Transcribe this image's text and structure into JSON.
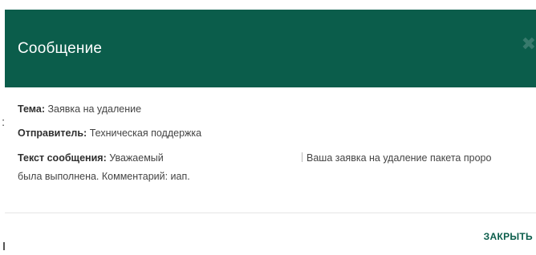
{
  "dialog": {
    "title": "Сообщение",
    "close_icon": "close-icon",
    "close_button_label": "ЗАКРЫТЬ"
  },
  "message": {
    "subject_label": "Тема:",
    "subject_value": "Заявка на удаление",
    "sender_label": "Отправитель:",
    "sender_value": "Техническая поддержка",
    "text_label": "Текст сообщения:",
    "text_value_start": "Уважаемый",
    "text_value_right": "Ваша заявка на удаление пакета проро",
    "text_value_line2": "была выполнена. Комментарий: иап."
  },
  "background": {
    "colon": ":"
  },
  "colors": {
    "header": "#0b5d4b",
    "accent": "#0b5d4b",
    "text": "#333333"
  }
}
